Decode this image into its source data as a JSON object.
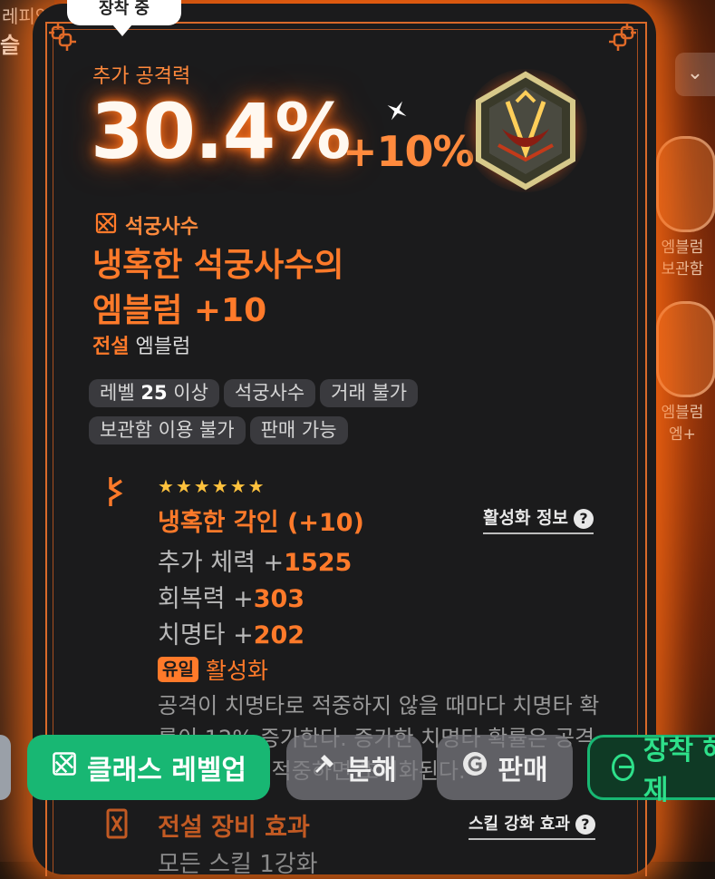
{
  "background": {
    "left_text_top": "레피언",
    "left_text_2": "슬"
  },
  "tooltip": {
    "label": "장착 중"
  },
  "stat": {
    "label": "추가 공격력",
    "value": "30.4%",
    "bonus": "+10%"
  },
  "item": {
    "class_name": "석궁사수",
    "name_line1": "냉혹한 석궁사수의",
    "name_line2": "엠블럼 +10",
    "rarity": "전설",
    "type": "엠블럼"
  },
  "tags": {
    "level_prefix": "레벨",
    "level_value": "25",
    "level_suffix": "이상",
    "class_tag": "석궁사수",
    "trade": "거래 불가",
    "storage": "보관함 이용 불가",
    "sell": "판매 가능"
  },
  "engraving": {
    "stars": "★★★★★★",
    "title": "냉혹한 각인 (+10)",
    "activate_link": "활성화 정보",
    "help": "?",
    "lines": [
      {
        "label": "추가 체력 +",
        "value": "1525"
      },
      {
        "label": "회복력 +",
        "value": "303"
      },
      {
        "label": "치명타 +",
        "value": "202"
      }
    ],
    "unique_badge": "유일",
    "unique_text": "활성화",
    "desc": "공격이 치명타로 적중하지 않을 때마다 치명타 확률이 12% 증가한다. 증가한 치명타 확률은 공격이 치명타로 적중하면 초기화된다."
  },
  "legend": {
    "title": "전설 장비 효과",
    "skill_link": "스킬 강화 효과",
    "line": "모든 스킬 1강화"
  },
  "side": {
    "label1_a": "엠블럼",
    "label1_b": "보관함",
    "label2_a": "엠블럼",
    "label2_b": "엠+"
  },
  "buttons": {
    "levelup": "클래스 레벨업",
    "disassemble": "분해",
    "sell": "판매",
    "equip": "장착 해제"
  },
  "colors": {
    "accent": "#ff7a2a",
    "glow": "#ff6e14",
    "primary_button": "#18b773"
  }
}
